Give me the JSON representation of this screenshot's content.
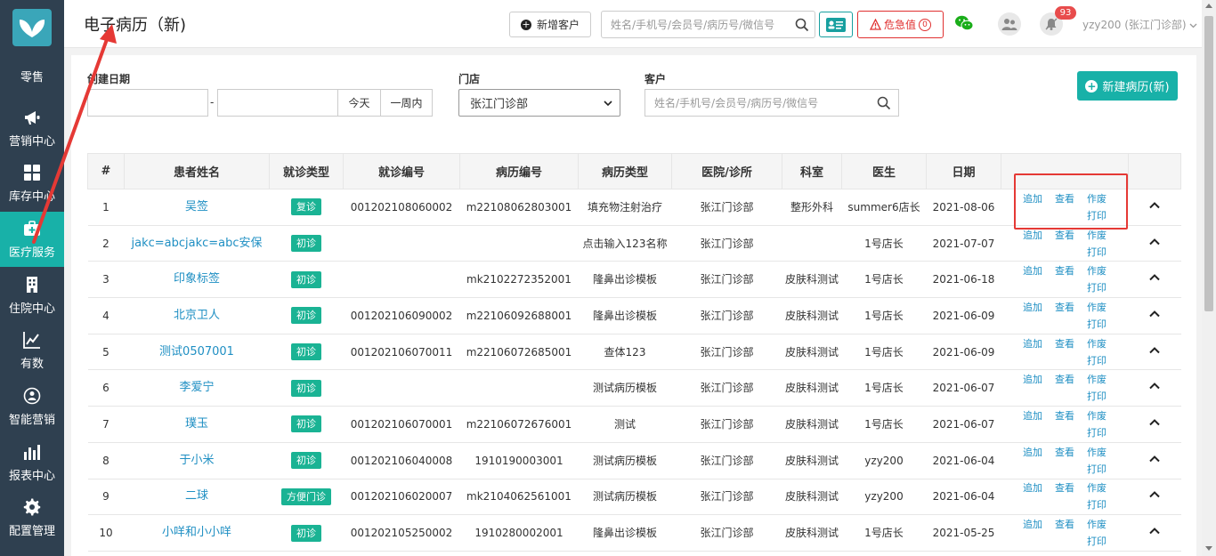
{
  "sidebar": {
    "items": [
      {
        "label": "零售",
        "icon": "retail-icon"
      },
      {
        "label": "营销中心",
        "icon": "megaphone-icon"
      },
      {
        "label": "库存中心",
        "icon": "grid-icon"
      },
      {
        "label": "医疗服务",
        "icon": "medical-kit-icon",
        "active": true
      },
      {
        "label": "住院中心",
        "icon": "hospital-icon"
      },
      {
        "label": "有数",
        "icon": "trend-icon"
      },
      {
        "label": "智能营销",
        "icon": "smart-marketing-icon"
      },
      {
        "label": "报表中心",
        "icon": "bar-chart-icon"
      },
      {
        "label": "配置管理",
        "icon": "gear-icon"
      }
    ]
  },
  "header": {
    "title": "电子病历（新)",
    "new_customer": "新增客户",
    "search_placeholder": "姓名/手机号/会员号/病历号/微信号",
    "alert_label": "危急值",
    "alert_count": "0",
    "bell_badge": "93",
    "user": "yzy200 (张江门诊部)"
  },
  "filters": {
    "date_label": "创建日期",
    "dash": "-",
    "today": "今天",
    "week": "一周内",
    "store_label": "门店",
    "store_value": "张江门诊部",
    "customer_label": "客户",
    "customer_placeholder": "姓名/手机号/会员号/病历号/微信号",
    "new_record": "新建病历(新)"
  },
  "table": {
    "headers": [
      "#",
      "患者姓名",
      "就诊类型",
      "就诊编号",
      "病历编号",
      "病历类型",
      "医院/诊所",
      "科室",
      "医生",
      "日期",
      "",
      ""
    ],
    "actions": {
      "add": "追加",
      "view": "查看",
      "void": "作废",
      "print": "打印"
    },
    "rows": [
      {
        "n": "1",
        "name": "吴签",
        "type": "复诊",
        "visit_no": "001202108060002",
        "record_no": "m22108062803001",
        "record_type": "填充物注射治疗",
        "clinic": "张江门诊部",
        "dept": "整形外科",
        "doctor": "summer6店长",
        "date": "2021-08-06"
      },
      {
        "n": "2",
        "name": "jakc=abcjakc=abc安保",
        "type": "初诊",
        "visit_no": "",
        "record_no": "",
        "record_type": "点击输入123名称",
        "clinic": "张江门诊部",
        "dept": "",
        "doctor": "1号店长",
        "date": "2021-07-07"
      },
      {
        "n": "3",
        "name": "印象标签",
        "type": "初诊",
        "visit_no": "",
        "record_no": "mk2102272352001",
        "record_type": "隆鼻出诊模板",
        "clinic": "张江门诊部",
        "dept": "皮肤科测试",
        "doctor": "1号店长",
        "date": "2021-06-18"
      },
      {
        "n": "4",
        "name": "北京卫人",
        "type": "初诊",
        "visit_no": "001202106090002",
        "record_no": "m22106092688001",
        "record_type": "隆鼻出诊模板",
        "clinic": "张江门诊部",
        "dept": "皮肤科测试",
        "doctor": "1号店长",
        "date": "2021-06-09"
      },
      {
        "n": "5",
        "name": "测试0507001",
        "type": "初诊",
        "visit_no": "001202106070011",
        "record_no": "m22106072685001",
        "record_type": "查体123",
        "clinic": "张江门诊部",
        "dept": "皮肤科测试",
        "doctor": "1号店长",
        "date": "2021-06-09"
      },
      {
        "n": "6",
        "name": "李爱宁",
        "type": "初诊",
        "visit_no": "",
        "record_no": "",
        "record_type": "测试病历模板",
        "clinic": "张江门诊部",
        "dept": "皮肤科测试",
        "doctor": "1号店长",
        "date": "2021-06-07"
      },
      {
        "n": "7",
        "name": "璞玉",
        "type": "初诊",
        "visit_no": "001202106070001",
        "record_no": "m22106072676001",
        "record_type": "测试",
        "clinic": "张江门诊部",
        "dept": "皮肤科测试",
        "doctor": "1号店长",
        "date": "2021-06-07"
      },
      {
        "n": "8",
        "name": "于小米",
        "type": "初诊",
        "visit_no": "001202106040008",
        "record_no": "1910190003001",
        "record_type": "测试病历模板",
        "clinic": "张江门诊部",
        "dept": "皮肤科测试",
        "doctor": "yzy200",
        "date": "2021-06-04"
      },
      {
        "n": "9",
        "name": "二球",
        "type": "方便门诊",
        "visit_no": "001202106020007",
        "record_no": "mk2104062561001",
        "record_type": "测试病历模板",
        "clinic": "张江门诊部",
        "dept": "皮肤科测试",
        "doctor": "yzy200",
        "date": "2021-06-04"
      },
      {
        "n": "10",
        "name": "小咩和小小咩",
        "type": "初诊",
        "visit_no": "001202105250002",
        "record_no": "1910280002001",
        "record_type": "隆鼻出诊模板",
        "clinic": "张江门诊部",
        "dept": "皮肤科测试",
        "doctor": "1号店长",
        "date": "2021-05-25"
      }
    ]
  },
  "colors": {
    "accent": "#18b1a8",
    "sidebar": "#2f4050",
    "link": "#1f8fc3",
    "alert": "#e03030",
    "annotation": "#e53935"
  }
}
